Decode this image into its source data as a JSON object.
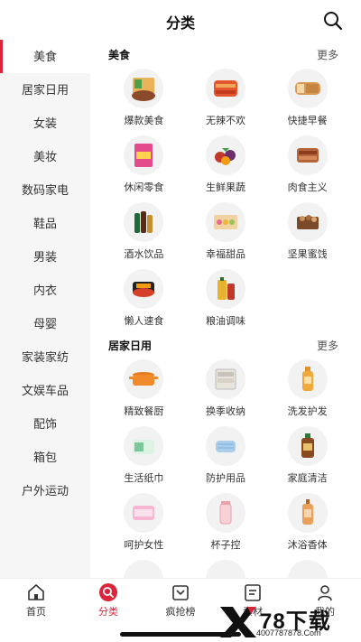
{
  "header": {
    "title": "分类"
  },
  "sidebar": {
    "items": [
      {
        "label": "美食",
        "active": true
      },
      {
        "label": "居家日用"
      },
      {
        "label": "女装"
      },
      {
        "label": "美妆"
      },
      {
        "label": "数码家电"
      },
      {
        "label": "鞋品"
      },
      {
        "label": "男装"
      },
      {
        "label": "内衣"
      },
      {
        "label": "母婴"
      },
      {
        "label": "家装家纺"
      },
      {
        "label": "文娱车品"
      },
      {
        "label": "配饰"
      },
      {
        "label": "箱包"
      },
      {
        "label": "户外运动"
      }
    ]
  },
  "sections": [
    {
      "title": "美食",
      "more": "更多",
      "items": [
        {
          "label": "爆款美食",
          "icon": "noodle-bowl-icon"
        },
        {
          "label": "无辣不欢",
          "icon": "spicy-meat-icon"
        },
        {
          "label": "快捷早餐",
          "icon": "bread-icon"
        },
        {
          "label": "休闲零食",
          "icon": "snack-bag-icon"
        },
        {
          "label": "生鲜果蔬",
          "icon": "fruit-icon"
        },
        {
          "label": "肉食主义",
          "icon": "sausage-icon"
        },
        {
          "label": "酒水饮品",
          "icon": "bottles-icon"
        },
        {
          "label": "幸福甜品",
          "icon": "dessert-box-icon"
        },
        {
          "label": "坚果蜜饯",
          "icon": "nuts-icon"
        },
        {
          "label": "懒人速食",
          "icon": "hotpot-icon"
        },
        {
          "label": "粮油调味",
          "icon": "oil-bottle-icon"
        }
      ]
    },
    {
      "title": "居家日用",
      "more": "更多",
      "items": [
        {
          "label": "精致餐厨",
          "icon": "casserole-icon"
        },
        {
          "label": "换季收纳",
          "icon": "storage-drawer-icon"
        },
        {
          "label": "洗发护发",
          "icon": "shampoo-bottle-icon"
        },
        {
          "label": "生活纸巾",
          "icon": "tissue-pack-icon"
        },
        {
          "label": "防护用品",
          "icon": "face-mask-icon"
        },
        {
          "label": "家庭清洁",
          "icon": "cleaner-bottle-icon"
        },
        {
          "label": "呵护女性",
          "icon": "sanitary-pad-icon"
        },
        {
          "label": "杯子控",
          "icon": "water-cup-icon"
        },
        {
          "label": "沐浴香体",
          "icon": "body-wash-icon"
        }
      ]
    }
  ],
  "tabbar": {
    "items": [
      {
        "label": "首页",
        "icon": "home-icon"
      },
      {
        "label": "分类",
        "icon": "category-search-icon",
        "active": true
      },
      {
        "label": "疯抢榜",
        "icon": "ranking-icon"
      },
      {
        "label": "素材",
        "icon": "material-icon"
      },
      {
        "label": "我的",
        "icon": "profile-icon"
      }
    ]
  },
  "watermark": {
    "brand": "78下载",
    "url": "4007787878.Com"
  },
  "colors": {
    "accent": "#d9263b",
    "sidebar_bg": "#f6f6f6",
    "thumb_bg": "#f2f2f2"
  }
}
